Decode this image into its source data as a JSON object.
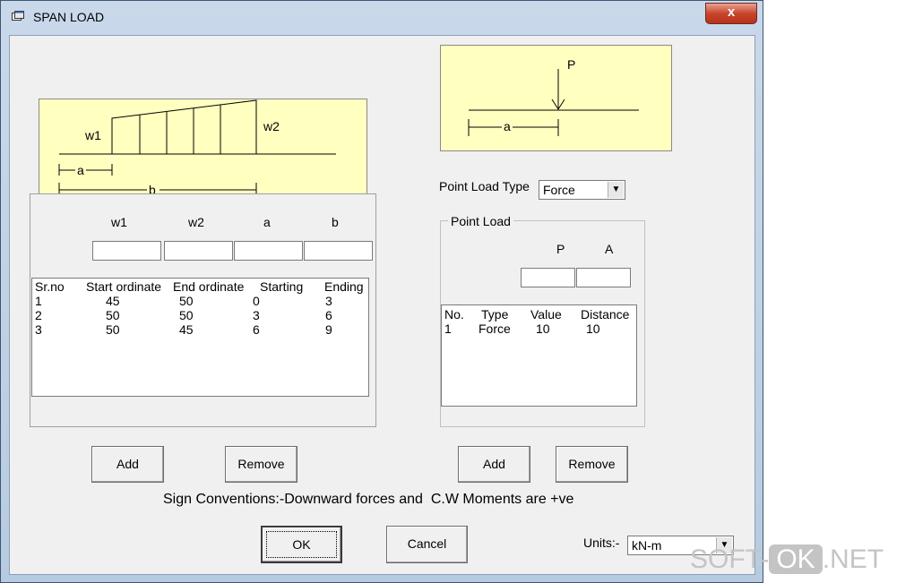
{
  "window": {
    "title": "SPAN LOAD",
    "close_label": "x"
  },
  "udl_diagram": {
    "w1": "w1",
    "w2": "w2",
    "a": "a",
    "b": "b"
  },
  "point_diagram": {
    "p": "P",
    "a": "a"
  },
  "span": {
    "headers": [
      "w1",
      "w2",
      "a",
      "b"
    ],
    "list_columns": [
      "Sr.no",
      "Start ordinate",
      "End ordinate",
      "Starting",
      "Ending"
    ],
    "rows": [
      [
        "1",
        "45",
        "50",
        "0",
        "3"
      ],
      [
        "2",
        "50",
        "50",
        "3",
        "6"
      ],
      [
        "3",
        "50",
        "45",
        "6",
        "9"
      ]
    ],
    "add_label": "Add",
    "remove_label": "Remove"
  },
  "point": {
    "type_label": "Point Load Type",
    "type_value": "Force",
    "group_label": "Point Load",
    "headers": [
      "P",
      "A"
    ],
    "list_columns": [
      "No.",
      "Type",
      "Value",
      "Distance"
    ],
    "rows": [
      [
        "1",
        "Force",
        "10",
        "10"
      ]
    ],
    "add_label": "Add",
    "remove_label": "Remove"
  },
  "sign_convention": "Sign Conventions:-Downward forces and  C.W Moments are +ve",
  "ok_label": "OK",
  "cancel_label": "Cancel",
  "units_label": "Units:-",
  "units_value": "kN-m",
  "watermark": {
    "left": "SOFT-",
    "badge": "OK",
    "right": ".NET"
  }
}
